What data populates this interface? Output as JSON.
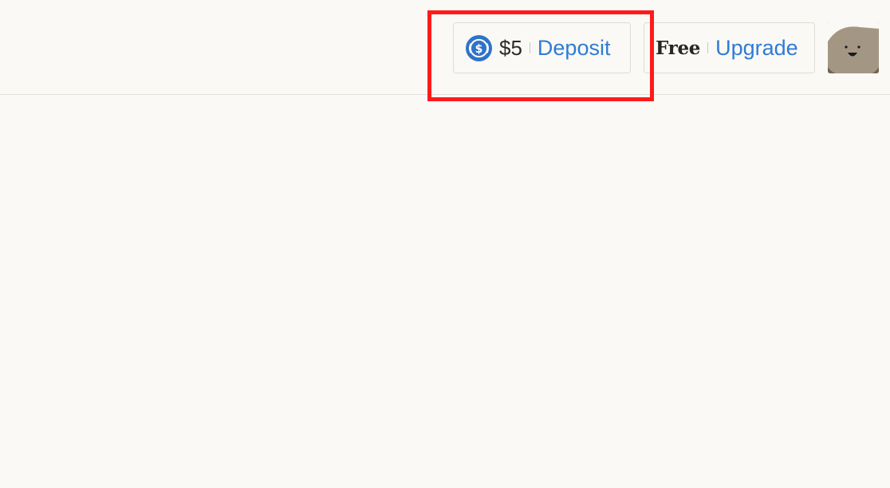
{
  "header": {
    "balance": {
      "icon": "usd-coin-icon",
      "amount": "$5",
      "action_label": "Deposit"
    },
    "plan": {
      "name": "Free",
      "action_label": "Upgrade"
    },
    "avatar": {
      "icon": "smiley-face-icon"
    }
  },
  "colors": {
    "background": "#faf9f5",
    "link": "#2f7bd6",
    "coin": "#2f73c9",
    "avatar_bg": "#a39784",
    "highlight": "#ff1a1a"
  }
}
